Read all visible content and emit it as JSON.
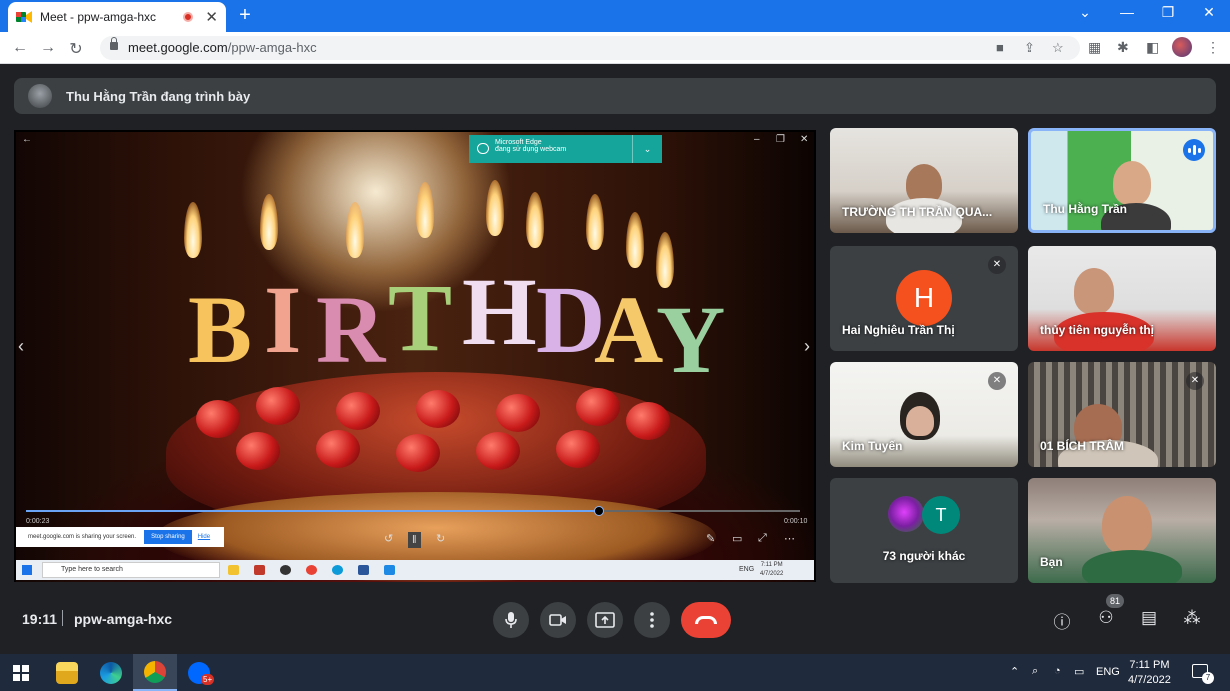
{
  "browser": {
    "tab_title": "Meet - ppw-amga-hxc",
    "new_tab": "+",
    "url_host": "meet.google.com",
    "url_path": "/ppw-amga-hxc",
    "window_controls": [
      "⌄",
      "—",
      "❐",
      "✕"
    ]
  },
  "presenter": {
    "label": "Thu Hằng Trần đang trình bày"
  },
  "shared_screen": {
    "edge_notice_title": "Microsoft Edge",
    "edge_notice_subtitle": "đang sử dụng webcam",
    "cake_letters": [
      "B",
      "I",
      "R",
      "T",
      "H",
      "D",
      "A",
      "Y"
    ],
    "progress_fraction": 0.74,
    "time_elapsed": "0:00:23",
    "time_total": "0:00:10",
    "share_text": "meet.google.com is sharing your screen.",
    "stop_sharing": "Stop sharing",
    "hide": "Hide",
    "search_placeholder": "Type here to search",
    "lang": "ENG",
    "clock_time": "7:11 PM",
    "clock_date": "4/7/2022"
  },
  "tiles": [
    {
      "name": "TRƯỜNG TH TRẦN QUA...",
      "muted": false
    },
    {
      "name": "Thu Hằng Trần",
      "muted": false,
      "speaking": true
    },
    {
      "name": "Hai Nghiêu Trần Thị",
      "muted": true,
      "initial": "H"
    },
    {
      "name": "thủy tiên nguyễn thị",
      "muted": false
    },
    {
      "name": "Kim Tuyến",
      "muted": true
    },
    {
      "name": "01 BÍCH TRÂM",
      "muted": true
    },
    {
      "name": "73 người khác",
      "initial": "T"
    },
    {
      "name": "Bạn",
      "muted": false
    }
  ],
  "bottom": {
    "time": "19:11",
    "code": "ppw-amga-hxc",
    "participants_count": "81"
  },
  "taskbar": {
    "lang": "ENG",
    "time": "7:11 PM",
    "date": "4/7/2022",
    "notif_count": "7",
    "chat_badge": "5+"
  },
  "colors": {
    "meet_bg": "#202124",
    "tile_bg": "#3c4043",
    "accent": "#1a73e8",
    "end_call": "#ea4335",
    "avatar_h": "#f4511e",
    "avatar_t": "#00897b"
  }
}
